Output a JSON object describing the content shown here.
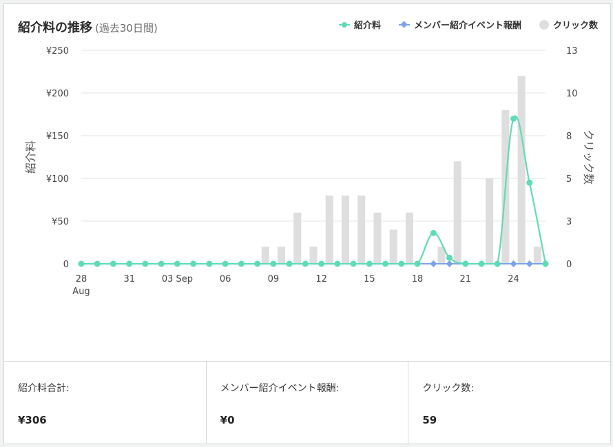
{
  "header": {
    "title": "紹介料の推移",
    "subtitle": "(過去30日間)"
  },
  "legend": [
    {
      "name": "紹介料",
      "color": "#5fdbb8",
      "shape": "line"
    },
    {
      "name": "メンバー紹介イベント報酬",
      "color": "#7aa3e8",
      "shape": "diamond"
    },
    {
      "name": "クリック数",
      "color": "#dedede",
      "shape": "circle"
    }
  ],
  "chart_data": {
    "type": "bar",
    "x_ticks": [
      {
        "index": 0,
        "label": "28",
        "sublabel": "Aug"
      },
      {
        "index": 3,
        "label": "31"
      },
      {
        "index": 6,
        "label": "03 Sep"
      },
      {
        "index": 9,
        "label": "06"
      },
      {
        "index": 12,
        "label": "09"
      },
      {
        "index": 15,
        "label": "12"
      },
      {
        "index": 18,
        "label": "15"
      },
      {
        "index": 21,
        "label": "18"
      },
      {
        "index": 24,
        "label": "21"
      },
      {
        "index": 27,
        "label": "24"
      }
    ],
    "ylabel_left": "紹介料",
    "ylabel_right": "クリック数",
    "y_left_ticks": [
      "0",
      "¥50",
      "¥100",
      "¥150",
      "¥200",
      "¥250"
    ],
    "y_left_range": [
      0,
      250
    ],
    "y_right_ticks": [
      "0",
      "3",
      "5",
      "8",
      "10",
      "13"
    ],
    "y_right_range": [
      0,
      12.5
    ],
    "grid": true,
    "series": [
      {
        "name": "クリック数",
        "kind": "bar",
        "axis": "right",
        "color": "#dedede",
        "values": [
          0,
          0,
          0,
          0,
          0,
          0,
          0,
          0,
          0,
          0,
          0,
          1,
          1,
          3,
          1,
          4,
          4,
          4,
          3,
          2,
          3,
          0,
          1,
          6,
          0,
          5,
          9,
          11,
          1
        ]
      },
      {
        "name": "紹介料",
        "kind": "line",
        "axis": "left",
        "color": "#5fdbb8",
        "values": [
          0,
          0,
          0,
          0,
          0,
          0,
          0,
          0,
          0,
          0,
          0,
          0,
          0,
          0,
          0,
          0,
          0,
          0,
          0,
          0,
          0,
          0,
          36,
          7,
          0,
          0,
          0,
          170,
          95,
          0
        ]
      },
      {
        "name": "メンバー紹介イベント報酬",
        "kind": "line",
        "axis": "left",
        "color": "#7aa3e8",
        "values": [
          0,
          0,
          0,
          0,
          0,
          0,
          0,
          0,
          0,
          0,
          0,
          0,
          0,
          0,
          0,
          0,
          0,
          0,
          0,
          0,
          0,
          0,
          0,
          0,
          0,
          0,
          0,
          0,
          0,
          0
        ]
      }
    ]
  },
  "summary": [
    {
      "label": "紹介料合計:",
      "value": "¥306"
    },
    {
      "label": "メンバー紹介イベント報酬:",
      "value": "¥0"
    },
    {
      "label": "クリック数:",
      "value": "59"
    }
  ]
}
